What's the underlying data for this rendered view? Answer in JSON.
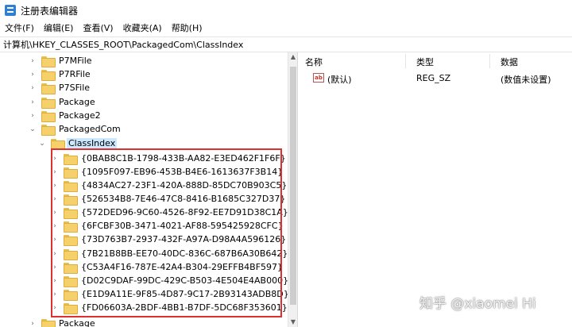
{
  "window": {
    "title": "注册表编辑器"
  },
  "menu": [
    "文件(F)",
    "编辑(E)",
    "查看(V)",
    "收藏夹(A)",
    "帮助(H)"
  ],
  "address": "计算机\\HKEY_CLASSES_ROOT\\PackagedCom\\ClassIndex",
  "tree": {
    "siblings_above": [
      {
        "label": "P7MFile",
        "expandable": true
      },
      {
        "label": "P7RFile",
        "expandable": true
      },
      {
        "label": "P7SFile",
        "expandable": true
      },
      {
        "label": "Package",
        "expandable": true
      },
      {
        "label": "Package2",
        "expandable": true
      },
      {
        "label": "PackagedCom",
        "expandable": true,
        "expanded": true
      }
    ],
    "selected": {
      "label": "ClassIndex",
      "expanded": true
    },
    "children": [
      "{0BAB8C1B-1798-433B-AA82-E3ED462F1F6F}",
      "{1095F097-EB96-453B-B4E6-1613637F3B14}",
      "{4834AC27-23F1-420A-888D-85DC70B903C5}",
      "{526534B8-7E46-47C8-8416-B1685C327D37}",
      "{572DED96-9C60-4526-8F92-EE7D91D38C1A}",
      "{6FCBF30B-3471-4021-AF88-595425928CFC}",
      "{73D763B7-2937-432F-A97A-D98A4A596126}",
      "{7B21B8BB-EE70-40DC-836C-687B6A30B642}",
      "{C53A4F16-787E-42A4-B304-29EFFB4BF597}",
      "{D02C9DAF-99DC-429C-B503-4E504E4AB000}",
      "{E1D9A11E-9F85-4D87-9C17-2B93143ADB8D}",
      "{FD06603A-2BDF-4BB1-B7DF-5DC68F353601}"
    ],
    "sibling_below": {
      "label": "Package",
      "expandable": true
    }
  },
  "list": {
    "headers": {
      "name": "名称",
      "type": "类型",
      "data": "数据"
    },
    "rows": [
      {
        "icon": "string-value-icon",
        "name": "(默认)",
        "type": "REG_SZ",
        "data": "(数值未设置)"
      }
    ]
  },
  "watermark": "知乎 @xiaomei Hi",
  "colors": {
    "selection": "#cce8ff",
    "highlight_border": "#e02f2f",
    "folder": "#f6d06a"
  }
}
